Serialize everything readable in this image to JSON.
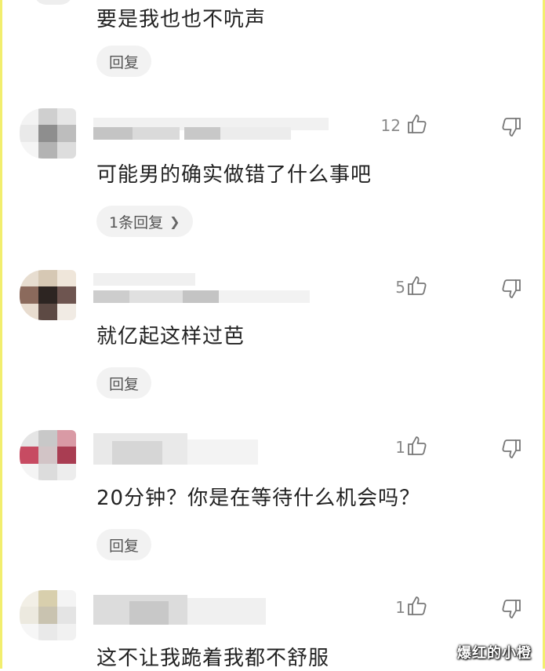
{
  "comments": [
    {
      "text": "要是我也也不吭声",
      "reply_label": "回复",
      "partial": true
    },
    {
      "likes": "12",
      "text": "可能男的确实做错了什么事吧",
      "reply_label": "1条回复",
      "has_chevron": true
    },
    {
      "likes": "5",
      "text": "就亿起这样过芭",
      "reply_label": "回复"
    },
    {
      "likes": "1",
      "text": "20分钟？你是在等待什么机会吗？",
      "reply_label": "回复"
    },
    {
      "likes": "1",
      "text": "这不让我跪着我都不舒服"
    }
  ],
  "icons": {
    "like": "thumbs-up-icon",
    "dislike": "thumbs-down-icon",
    "chevron": "chevron-right-icon"
  },
  "watermark": "爆红的小橙",
  "colors": {
    "frame_border": "#f2ee6e",
    "text": "#222222",
    "meta": "#8a8a8a",
    "reply_bg": "#f2f2f2"
  }
}
